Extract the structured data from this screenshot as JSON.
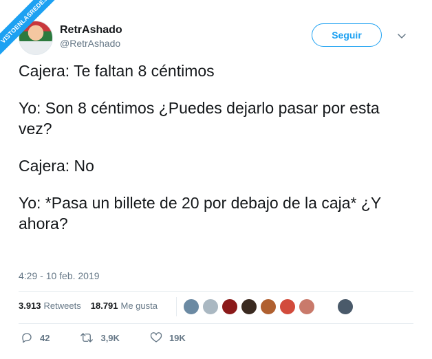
{
  "watermark": "VISTOENLASREDES",
  "author": {
    "display_name": "RetrAshado",
    "handle": "@RetrAshado"
  },
  "follow_button_label": "Seguir",
  "tweet": {
    "paragraphs": [
      "Cajera: Te faltan 8 céntimos",
      "Yo: Son 8 céntimos ¿Puedes dejarlo pasar por esta vez?",
      "Cajera: No",
      "Yo: *Pasa un billete de 20 por debajo de la caja* ¿Y ahora?"
    ],
    "timestamp": "4:29 - 10 feb. 2019"
  },
  "stats": {
    "retweets_count": "3.913",
    "retweets_label": "Retweets",
    "likes_count": "18.791",
    "likes_label": "Me gusta"
  },
  "likers_colors": [
    "#6b8aa3",
    "#aab8c2",
    "#8b1a1a",
    "#3a2a20",
    "#b06030",
    "#d24b3c",
    "#c97a6b",
    "#ffffff",
    "#4a5a6a"
  ],
  "actions": {
    "replies": "42",
    "retweets": "3,9K",
    "likes": "19K"
  },
  "colors": {
    "accent": "#1da1f2",
    "secondary_text": "#657786"
  }
}
